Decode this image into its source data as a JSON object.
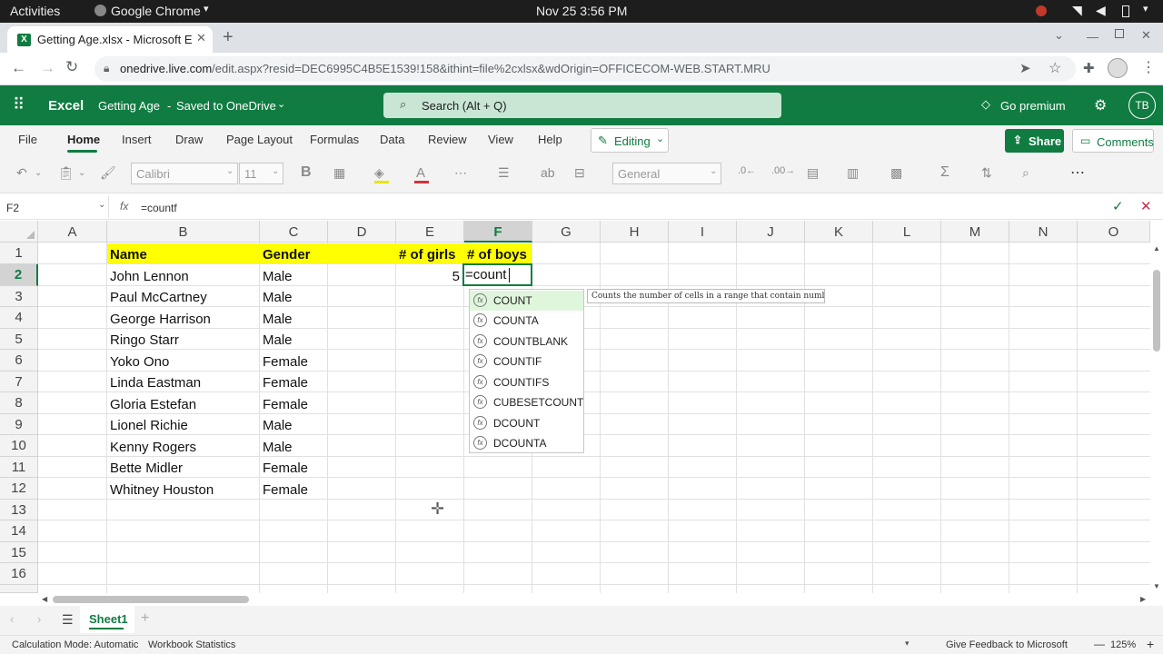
{
  "system": {
    "activities": "Activities",
    "app_name": "Google Chrome",
    "datetime": "Nov 25  3:56 PM"
  },
  "browser": {
    "tab_title": "Getting Age.xlsx - Microsoft Excel Online",
    "url_host": "onedrive.live.com",
    "url_path": "/edit.aspx?resid=DEC6995C4B5E1539!158&ithint=file%2cxlsx&wdOrigin=OFFICECOM-WEB.START.MRU"
  },
  "excel_header": {
    "app": "Excel",
    "doc_title": "Getting Age",
    "save_status": "Saved to OneDrive",
    "search_placeholder": "Search (Alt + Q)",
    "go_premium": "Go premium",
    "avatar_initials": "TB"
  },
  "ribbon": {
    "tabs": [
      "File",
      "Home",
      "Insert",
      "Draw",
      "Page Layout",
      "Formulas",
      "Data",
      "Review",
      "View",
      "Help"
    ],
    "active_tab": "Home",
    "editing": "Editing",
    "share": "Share",
    "comments": "Comments",
    "font_name": "Calibri",
    "font_size": "11",
    "number_format": "General"
  },
  "formula_bar": {
    "name_box": "F2",
    "fx": "fx",
    "formula": "=countf"
  },
  "grid": {
    "columns": [
      "A",
      "B",
      "C",
      "D",
      "E",
      "F",
      "G",
      "H",
      "I",
      "J",
      "K",
      "L",
      "M",
      "N",
      "O"
    ],
    "rows": [
      "1",
      "2",
      "3",
      "4",
      "5",
      "6",
      "7",
      "8",
      "9",
      "10",
      "11",
      "12",
      "13",
      "14",
      "15",
      "16"
    ],
    "headers": {
      "name": "Name",
      "gender": "Gender",
      "girls": "# of girls",
      "boys": "# of boys"
    },
    "people": [
      {
        "name": "John Lennon",
        "gender": "Male"
      },
      {
        "name": "Paul McCartney",
        "gender": "Male"
      },
      {
        "name": "George Harrison",
        "gender": "Male"
      },
      {
        "name": "Ringo Starr",
        "gender": "Male"
      },
      {
        "name": "Yoko Ono",
        "gender": "Female"
      },
      {
        "name": "Linda Eastman",
        "gender": "Female"
      },
      {
        "name": "Gloria Estefan",
        "gender": "Female"
      },
      {
        "name": "Lionel Richie",
        "gender": "Male"
      },
      {
        "name": "Kenny Rogers",
        "gender": "Male"
      },
      {
        "name": "Bette Midler",
        "gender": "Female"
      },
      {
        "name": "Whitney Houston",
        "gender": "Female"
      }
    ],
    "girls_count": "5",
    "active_cell_edit": "=count"
  },
  "autocomplete": {
    "items": [
      "COUNT",
      "COUNTA",
      "COUNTBLANK",
      "COUNTIF",
      "COUNTIFS",
      "CUBESETCOUNT",
      "DCOUNT",
      "DCOUNTA"
    ],
    "tooltip": "Counts the number of cells in a range that contain numbers"
  },
  "sheets": {
    "active": "Sheet1"
  },
  "status_bar": {
    "calc_mode": "Calculation Mode: Automatic",
    "workbook_stats": "Workbook Statistics",
    "feedback": "Give Feedback to Microsoft",
    "zoom": "125%"
  }
}
